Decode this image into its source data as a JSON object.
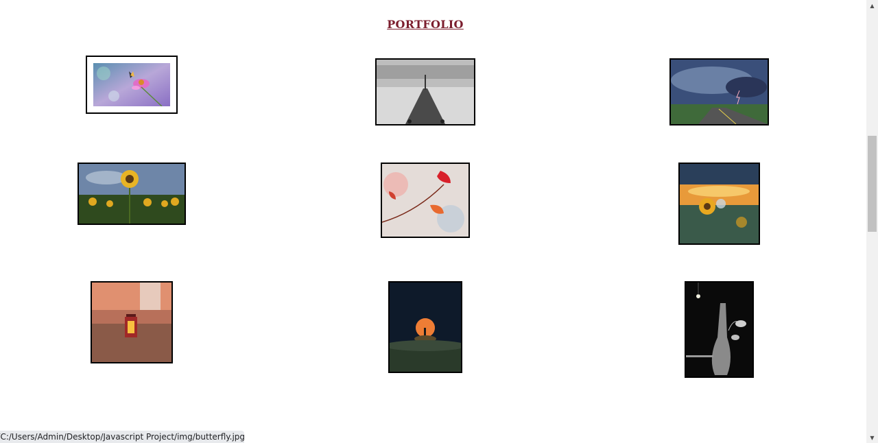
{
  "page": {
    "title": "PORTFOLIO",
    "title_color": "#7b1e2e"
  },
  "gallery": {
    "images": [
      {
        "name": "butterfly",
        "icon": "butterfly-on-purple-flower-photo"
      },
      {
        "name": "pier",
        "icon": "black-white-pier-photo"
      },
      {
        "name": "storm",
        "icon": "storm-road-lightning-photo"
      },
      {
        "name": "sunflowers",
        "icon": "sunflower-field-photo"
      },
      {
        "name": "leaves",
        "icon": "red-autumn-leaves-photo"
      },
      {
        "name": "sunflower-sunset",
        "icon": "sunflower-sunset-photo"
      },
      {
        "name": "lantern",
        "icon": "lantern-wheat-field-photo"
      },
      {
        "name": "moon",
        "icon": "red-moon-silhouette-photo"
      },
      {
        "name": "vase",
        "icon": "vase-plant-bulb-photo"
      }
    ]
  },
  "status": {
    "url": "file:///C:/Users/Admin/Desktop/Javascript Project/img/butterfly.jpg"
  },
  "scrollbar": {
    "up_arrow": "▲",
    "down_arrow": "▼"
  }
}
